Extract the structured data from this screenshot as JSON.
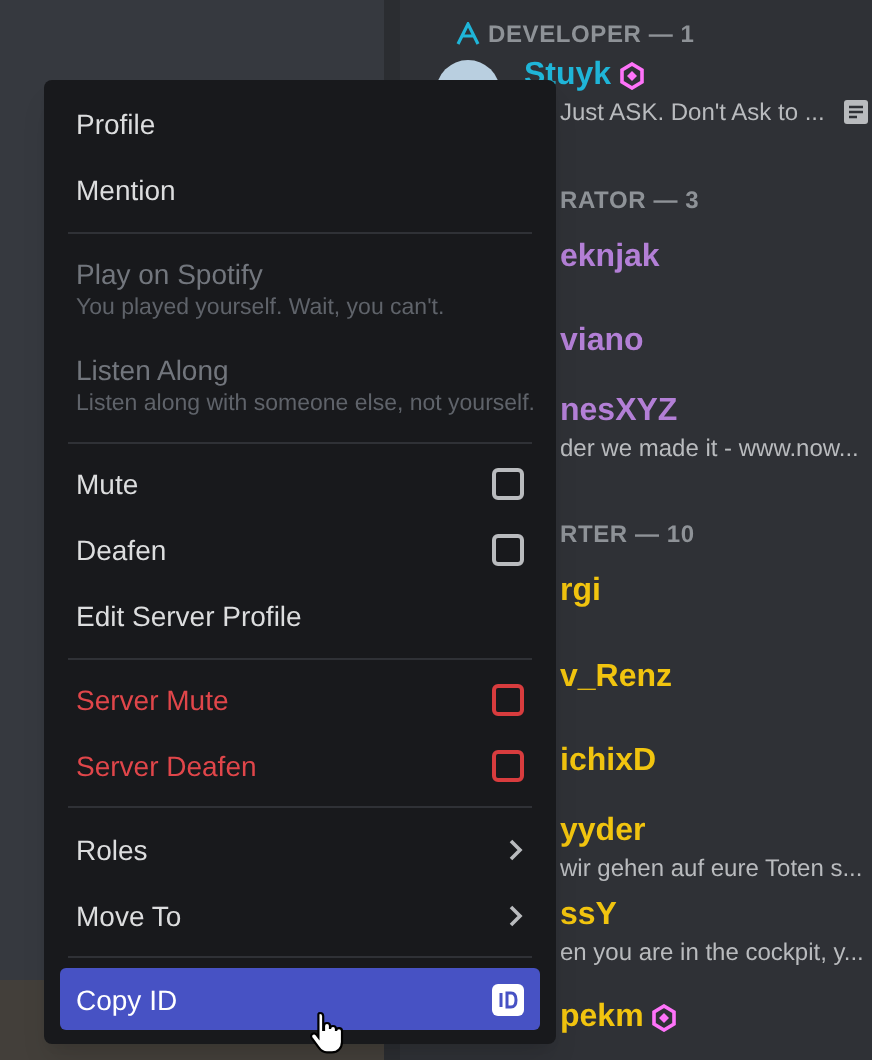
{
  "members": [
    {
      "kind": "header",
      "label": "DEVELOPER — 1",
      "icon": true
    },
    {
      "kind": "member",
      "name": "Stuyk",
      "color": "#1fb5d8",
      "status": "Just ASK. Don't Ask to ...",
      "boost": true,
      "note": true
    },
    {
      "kind": "header",
      "label": "RATOR — 3",
      "icon": false
    },
    {
      "kind": "partial",
      "name": "eknjak",
      "color": "#b37fd6",
      "boost": false
    },
    {
      "kind": "partial",
      "name": "viano",
      "color": "#b37fd6",
      "boost": false
    },
    {
      "kind": "partial",
      "name": "nesXYZ",
      "color": "#b37fd6",
      "status": "der we made it - www.now...",
      "boost": false,
      "note": false
    },
    {
      "kind": "header",
      "label": "RTER — 10",
      "icon": false
    },
    {
      "kind": "partial",
      "name": "rgi",
      "color": "#f1c40f",
      "boost": false
    },
    {
      "kind": "partial",
      "name": "v_Renz",
      "color": "#f1c40f",
      "boost": false
    },
    {
      "kind": "partial",
      "name": "ichixD",
      "color": "#f1c40f",
      "boost": false
    },
    {
      "kind": "partial",
      "name": "yyder",
      "color": "#f1c40f",
      "status": "wir gehen auf eure Toten s...",
      "boost": false,
      "note": false
    },
    {
      "kind": "partial",
      "name": "ssY",
      "color": "#f1c40f",
      "status": "en you are in the cockpit, y...",
      "boost": false,
      "note": false
    },
    {
      "kind": "partial",
      "name": "pekm",
      "color": "#f1c40f",
      "boost": true
    }
  ],
  "menu": [
    [
      {
        "label": "Profile",
        "kind": "plain",
        "disabled": false,
        "danger": false,
        "selected": false
      },
      {
        "label": "Mention",
        "kind": "plain",
        "disabled": false,
        "danger": false,
        "selected": false
      }
    ],
    [
      {
        "label": "Play on Spotify",
        "hint": "You played yourself. Wait, you can't.",
        "kind": "plain",
        "disabled": true,
        "danger": false,
        "selected": false
      },
      {
        "label": "Listen Along",
        "hint": "Listen along with someone else, not yourself.",
        "kind": "plain",
        "disabled": true,
        "danger": false,
        "selected": false
      }
    ],
    [
      {
        "label": "Mute",
        "kind": "checkbox",
        "checked": false,
        "disabled": false,
        "danger": false,
        "selected": false
      },
      {
        "label": "Deafen",
        "kind": "checkbox",
        "checked": false,
        "disabled": false,
        "danger": false,
        "selected": false
      },
      {
        "label": "Edit Server Profile",
        "kind": "plain",
        "disabled": false,
        "danger": false,
        "selected": false
      }
    ],
    [
      {
        "label": "Server Mute",
        "kind": "checkbox",
        "checked": false,
        "disabled": false,
        "danger": true,
        "selected": false
      },
      {
        "label": "Server Deafen",
        "kind": "checkbox",
        "checked": false,
        "disabled": false,
        "danger": true,
        "selected": false
      }
    ],
    [
      {
        "label": "Roles",
        "kind": "submenu",
        "disabled": false,
        "danger": false,
        "selected": false
      },
      {
        "label": "Move To",
        "kind": "submenu",
        "disabled": false,
        "danger": false,
        "selected": false
      }
    ],
    [
      {
        "label": "Copy ID",
        "kind": "copy",
        "disabled": false,
        "danger": false,
        "selected": true
      }
    ]
  ]
}
